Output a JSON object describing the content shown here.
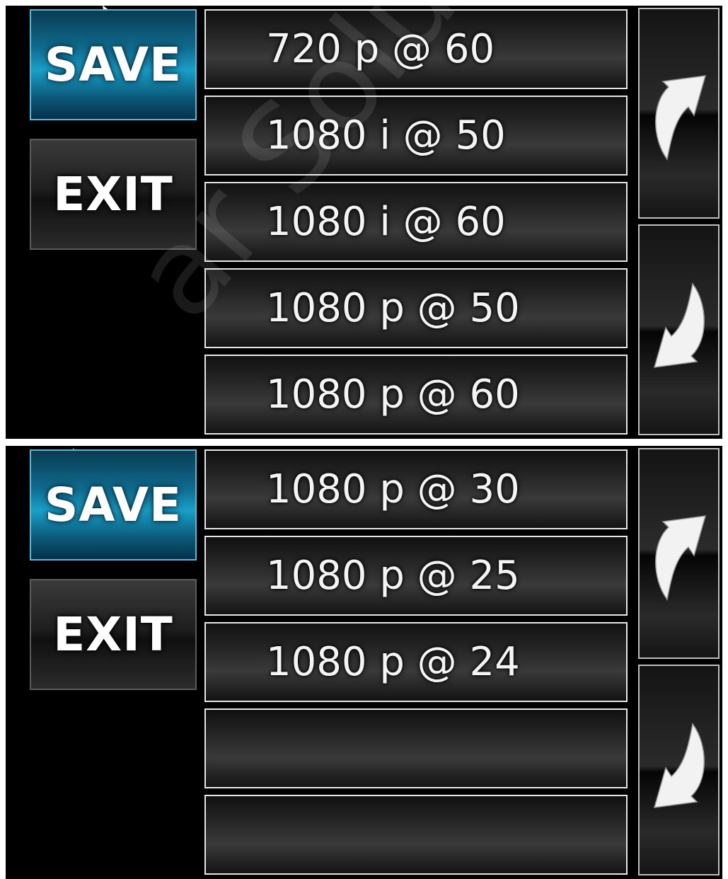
{
  "top_screen": {
    "save_label": "SAVE",
    "exit_label": "EXIT",
    "items": [
      {
        "label": "720 p @ 60"
      },
      {
        "label": "1080 i @ 50"
      },
      {
        "label": "1080 i @ 60"
      },
      {
        "label": "1080 p @ 50"
      },
      {
        "label": "1080 p @ 60"
      }
    ],
    "scroll_up_icon": "curved-arrow-up-icon",
    "scroll_down_icon": "curved-arrow-down-icon"
  },
  "bottom_screen": {
    "save_label": "SAVE",
    "exit_label": "EXIT",
    "items": [
      {
        "label": "1080 p @ 30"
      },
      {
        "label": "1080 p @ 25"
      },
      {
        "label": "1080 p @ 24"
      },
      {
        "label": ""
      },
      {
        "label": ""
      }
    ],
    "scroll_up_icon": "curved-arrow-up-icon",
    "scroll_down_icon": "curved-arrow-down-icon"
  },
  "colors": {
    "save_blue": "#0f6c90",
    "item_border": "#e6e6e6",
    "background": "#000000"
  },
  "watermark": "ar Solutions"
}
